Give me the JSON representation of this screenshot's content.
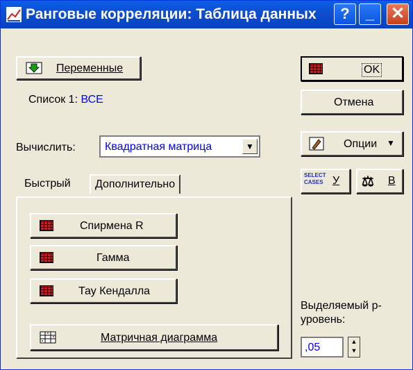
{
  "window": {
    "title": "Ранговые корреляции: Таблица данных"
  },
  "titlebar": {
    "help": "?",
    "minimize": "_",
    "close": "✕"
  },
  "variables_button": {
    "label": "Переменные"
  },
  "list": {
    "label": "Список 1:",
    "value": "ВСЕ"
  },
  "compute": {
    "label": "Вычислить:",
    "selected": "Квадратная матрица"
  },
  "tabs": [
    {
      "label": "Быстрый"
    },
    {
      "label": "Дополнительно"
    }
  ],
  "analysis_buttons": [
    {
      "label": "Спирмена R"
    },
    {
      "label": "Гамма"
    },
    {
      "label": "Тау Кендалла"
    },
    {
      "label": "Матричная диаграмма"
    }
  ],
  "side": {
    "ok": "OK",
    "cancel": "Отмена",
    "options": "Опции",
    "select_cases": "SELECT CASES",
    "select_key": "У",
    "weight_key": "В"
  },
  "p_level": {
    "label": "Выделяемый р-уровень:",
    "value": ",05"
  }
}
